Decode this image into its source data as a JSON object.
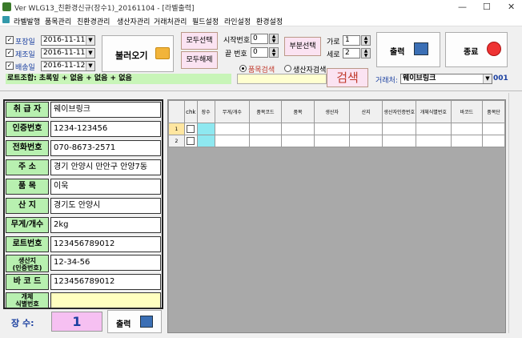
{
  "window": {
    "title": "Ver WLG13_친환경신규(장수1)_20161104 - [라벨출력]",
    "controls": [
      "—",
      "☐",
      "✕"
    ]
  },
  "menu": [
    "라벨발행",
    "품목관리",
    "친환경관리",
    "생산자관리",
    "거래처관리",
    "필드설정",
    "라인설정",
    "환경설정"
  ],
  "dates": [
    {
      "label": "포장일",
      "checked": true,
      "value": "2016-11-11"
    },
    {
      "label": "제조일",
      "checked": true,
      "value": "2016-11-11"
    },
    {
      "label": "배송일",
      "checked": true,
      "value": "2016-11-12"
    }
  ],
  "buttons": {
    "load": "불러오기",
    "select_all": "모두선택",
    "deselect_all": "모두해제",
    "partial": "부분선택",
    "print": "출력",
    "exit": "종료",
    "search": "검색",
    "bottom_print": "출력"
  },
  "range": {
    "start_label": "시작번호",
    "start_value": "0",
    "end_label": "끝 번호",
    "end_value": "0"
  },
  "size": {
    "w_label": "가로",
    "w_value": "1",
    "h_label": "세로",
    "h_value": "2"
  },
  "lot_text": "로트조합: 초록잎 + 없음 + 없음 + 없음",
  "search_opts": {
    "opt1": "품목검색",
    "opt2": "생산자검색"
  },
  "vendor": {
    "label": "거래처:",
    "value": "웨이브링크",
    "code": "001"
  },
  "form": [
    {
      "label": "취 급 자",
      "value": "웨이브링크"
    },
    {
      "label": "인증번호",
      "value": "1234-123456"
    },
    {
      "label": "전화번호",
      "value": "070-8673-2571"
    },
    {
      "label": "주  소",
      "value": "경기 안양시 만안구 안양7동"
    },
    {
      "label": "품  목",
      "value": "이욱"
    },
    {
      "label": "산  지",
      "value": "경기도 안양시"
    },
    {
      "label": "무게/개수",
      "value": "2kg"
    },
    {
      "label": "로트번호",
      "value": "123456789012"
    },
    {
      "label": "생산지\n(인증번호)",
      "value": "12-34-56"
    },
    {
      "label": "바 코 드",
      "value": "123456789012"
    },
    {
      "label": "개체\n식별번호",
      "value": ""
    }
  ],
  "count": {
    "label": "장  수:",
    "value": "1"
  },
  "grid": {
    "headers": [
      "chk",
      "장수",
      "무게/개수",
      "품목코드",
      "품목",
      "생산자",
      "산지",
      "생산자인증번호",
      "개체식별번호",
      "바코드",
      "품목단"
    ],
    "rows": [
      "1",
      "2"
    ]
  }
}
